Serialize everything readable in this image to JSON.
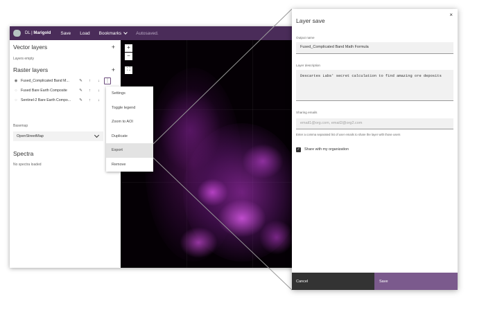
{
  "topbar": {
    "brand_prefix": "DL",
    "brand_separator": "|",
    "brand_name": "Marigold",
    "save_label": "Save",
    "load_label": "Load",
    "bookmarks_label": "Bookmarks",
    "status": "Autosaved."
  },
  "sidebar": {
    "vector_title": "Vector layers",
    "vector_empty": "Layers empty",
    "raster_title": "Raster layers",
    "raster_layers": [
      {
        "name": "Fused_Complicated Band M..."
      },
      {
        "name": "Fused Bare Earth Composite"
      },
      {
        "name": "Sentinel-2 Bare Earth Compo..."
      }
    ],
    "basemap_label": "Basemap",
    "basemap_value": "OpenStreetMap",
    "spectra_title": "Spectra",
    "spectra_empty": "No spectra loaded",
    "plus_symbol": "+"
  },
  "map": {
    "zoom_in": "+",
    "zoom_out": "−"
  },
  "context_menu": {
    "items": [
      "Settings",
      "Toggle legend",
      "Zoom to AOI",
      "Duplicate",
      "Export",
      "Remove"
    ],
    "active_item": "Export"
  },
  "dialog": {
    "title": "Layer save",
    "close_symbol": "×",
    "output_name_label": "Output name",
    "output_name_value": "Fused_Complicated Band Math Formula",
    "description_label": "Layer description",
    "description_value": "Descartes Labs' secret calculation to find amazing ore deposits",
    "emails_label": "Sharing emails",
    "emails_placeholder": "email1@org.com, email2@org2.com",
    "emails_hint": "Enter a comma separated list of user emails to share the layer with those users",
    "share_org_label": "Share with my organization",
    "share_org_checked": true,
    "cancel_label": "Cancel",
    "save_label": "Save"
  },
  "colors": {
    "topbar": "#4a2c59",
    "save_button": "#7b5a8d",
    "cancel_button": "#333333",
    "map_background": "#050005",
    "imagery_magenta": "#b43cc8"
  }
}
